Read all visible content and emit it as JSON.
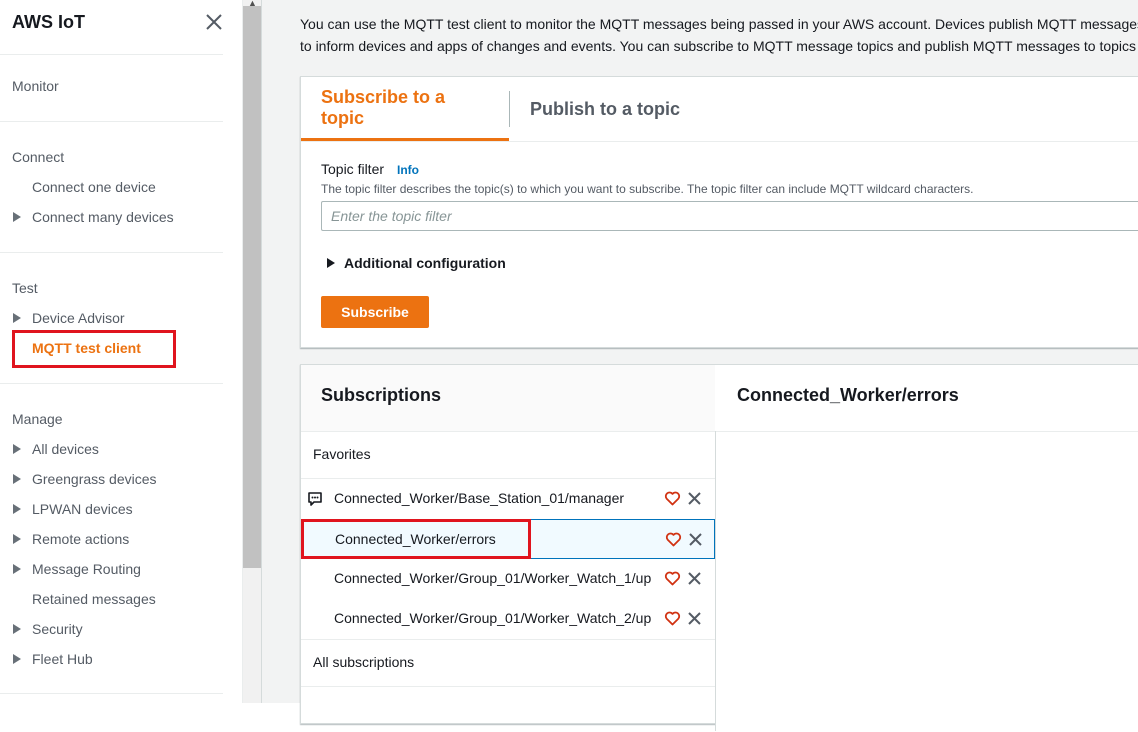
{
  "sidebar": {
    "brand": "AWS IoT",
    "close_icon": "close-icon",
    "sections": {
      "monitor": "Monitor",
      "connect": "Connect",
      "connect_one": "Connect one device",
      "connect_many": "Connect many devices",
      "test": "Test",
      "device_advisor": "Device Advisor",
      "mqtt_client": "MQTT test client",
      "manage": "Manage",
      "all_devices": "All devices",
      "greengrass": "Greengrass devices",
      "lpwan": "LPWAN devices",
      "remote_actions": "Remote actions",
      "message_routing": "Message Routing",
      "retained_messages": "Retained messages",
      "security": "Security",
      "fleet_hub": "Fleet Hub"
    }
  },
  "main": {
    "intro_line1": "You can use the MQTT test client to monitor the MQTT messages being passed in your AWS account. Devices publish MQTT messages",
    "intro_line2": "to inform devices and apps of changes and events. You can subscribe to MQTT message topics and publish MQTT messages to topics",
    "tabs": {
      "subscribe": "Subscribe to a topic",
      "publish": "Publish to a topic"
    },
    "topic_filter": {
      "label": "Topic filter",
      "info": "Info",
      "description": "The topic filter describes the topic(s) to which you want to subscribe. The topic filter can include MQTT wildcard characters.",
      "placeholder": "Enter the topic filter",
      "value": ""
    },
    "additional_config": "Additional configuration",
    "subscribe_button": "Subscribe"
  },
  "subscriptions": {
    "title": "Subscriptions",
    "selected_topic_title": "Connected_Worker/errors",
    "favorites_label": "Favorites",
    "all_label": "All subscriptions",
    "rows": [
      {
        "name": "Connected_Worker/Base_Station_01/manager"
      },
      {
        "name": "Connected_Worker/errors"
      },
      {
        "name": "Connected_Worker/Group_01/Worker_Watch_1/up"
      },
      {
        "name": "Connected_Worker/Group_01/Worker_Watch_2/up"
      }
    ]
  },
  "colors": {
    "accent": "#ec7211",
    "highlight": "#e0141e",
    "link": "#0073bb"
  }
}
